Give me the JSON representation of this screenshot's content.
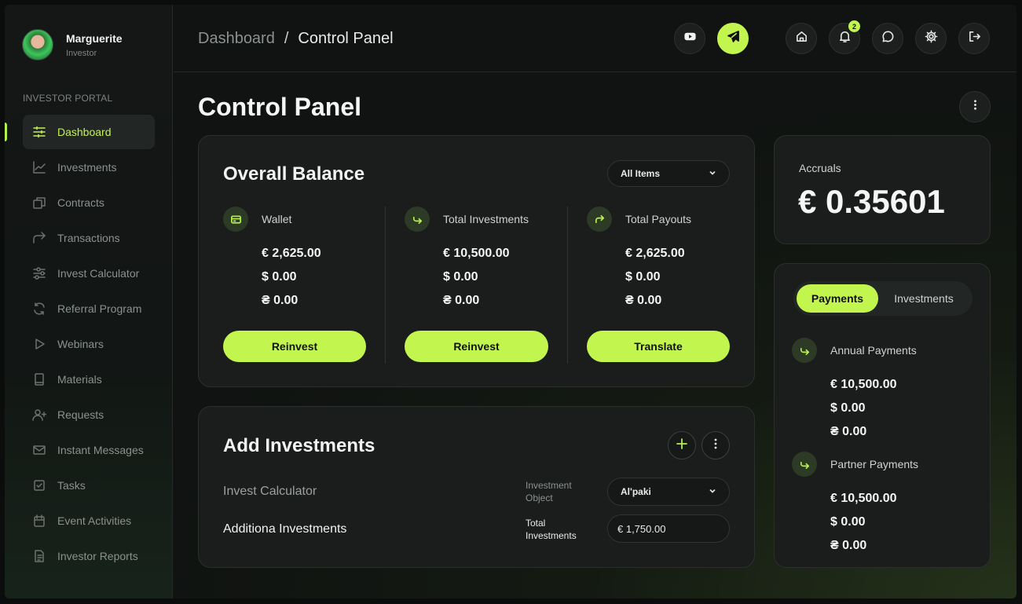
{
  "profile": {
    "name": "Marguerite",
    "role": "Investor"
  },
  "sidebar": {
    "section_label": "INVESTOR PORTAL",
    "items": [
      {
        "label": "Dashboard",
        "icon": "sliders-icon"
      },
      {
        "label": "Investments",
        "icon": "line-chart-icon"
      },
      {
        "label": "Contracts",
        "icon": "documents-icon"
      },
      {
        "label": "Transactions",
        "icon": "forward-arrow-icon"
      },
      {
        "label": "Invest Calculator",
        "icon": "adjustments-icon"
      },
      {
        "label": "Referral Program",
        "icon": "refresh-icon"
      },
      {
        "label": "Webinars",
        "icon": "play-icon"
      },
      {
        "label": "Materials",
        "icon": "book-icon"
      },
      {
        "label": "Requests",
        "icon": "user-plus-icon"
      },
      {
        "label": "Instant Messages",
        "icon": "mail-icon"
      },
      {
        "label": "Tasks",
        "icon": "checkbox-icon"
      },
      {
        "label": "Event Activities",
        "icon": "calendar-icon"
      },
      {
        "label": "Investor Reports",
        "icon": "report-icon"
      }
    ]
  },
  "header": {
    "breadcrumb_root": "Dashboard",
    "breadcrumb_sep": "/",
    "breadcrumb_current": "Control Panel",
    "notification_count": "2"
  },
  "page_title": "Control Panel",
  "balance": {
    "title": "Overall Balance",
    "filter": "All Items",
    "columns": [
      {
        "label": "Wallet",
        "values": [
          "€ 2,625.00",
          "$ 0.00",
          "₴ 0.00"
        ],
        "button": "Reinvest"
      },
      {
        "label": "Total Investments",
        "values": [
          "€ 10,500.00",
          "$ 0.00",
          "₴ 0.00"
        ],
        "button": "Reinvest"
      },
      {
        "label": "Total Payouts",
        "values": [
          "€ 2,625.00",
          "$ 0.00",
          "₴ 0.00"
        ],
        "button": "Translate"
      }
    ]
  },
  "add_investments": {
    "title": "Add Investments",
    "row1_label": "Invest Calculator",
    "row1_field_label": "Investment Object",
    "row1_value": "Al'paki",
    "row2_label": "Additiona Investments",
    "row2_field_label": "Total Investments",
    "row2_value": "€ 1,750.00"
  },
  "accruals": {
    "label": "Accruals",
    "value": "€ 0.35601"
  },
  "payments": {
    "tabs": [
      "Payments",
      "Investments"
    ],
    "blocks": [
      {
        "label": "Annual Payments",
        "values": [
          "€ 10,500.00",
          "$ 0.00",
          "₴ 0.00"
        ]
      },
      {
        "label": "Partner Payments",
        "values": [
          "€ 10,500.00",
          "$ 0.00",
          "₴ 0.00"
        ]
      }
    ]
  },
  "colors": {
    "accent": "#c3f54f",
    "background": "#101311",
    "card": "#1a1d1c"
  }
}
